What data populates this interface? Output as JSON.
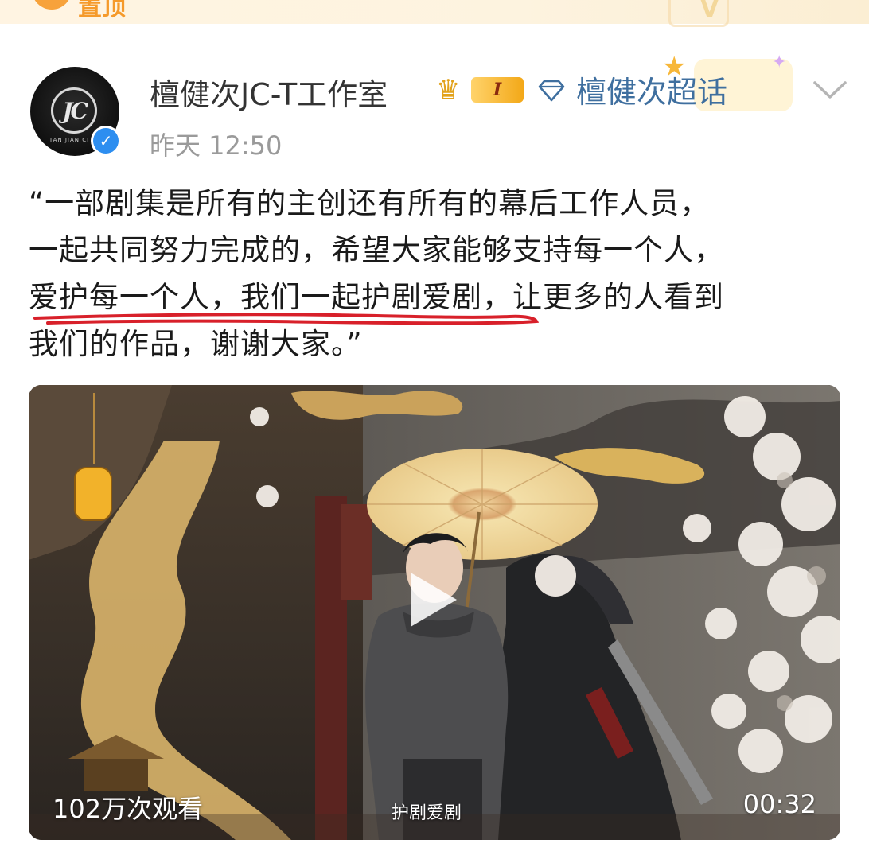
{
  "top_bar": {
    "label": "置顶"
  },
  "author": {
    "name": "檀健次JC-T工作室",
    "avatar_monogram": "JC",
    "avatar_caption": "TAN JIAN CI ST",
    "level": "I",
    "verified_icon": "verified-icon"
  },
  "topic": {
    "label": "檀健次超话",
    "icon": "diamond-icon"
  },
  "post": {
    "time": "昨天 12:50",
    "lines": [
      "“一部剧集是所有的主创还有所有的幕后工作人员，",
      "一起共同努力完成的，希望大家能够支持每一个人，",
      "爱护每一个人，我们一起护剧爱剧，让更多的人看到",
      "我们的作品，谢谢大家。”"
    ]
  },
  "video": {
    "views": "102万次观看",
    "caption": "护剧爱剧",
    "duration": "00:32"
  },
  "colors": {
    "link": "#3f6f9f",
    "timestamp": "#9a9a9a",
    "verified": "#2d8ef0",
    "underline": "#d8202a"
  }
}
